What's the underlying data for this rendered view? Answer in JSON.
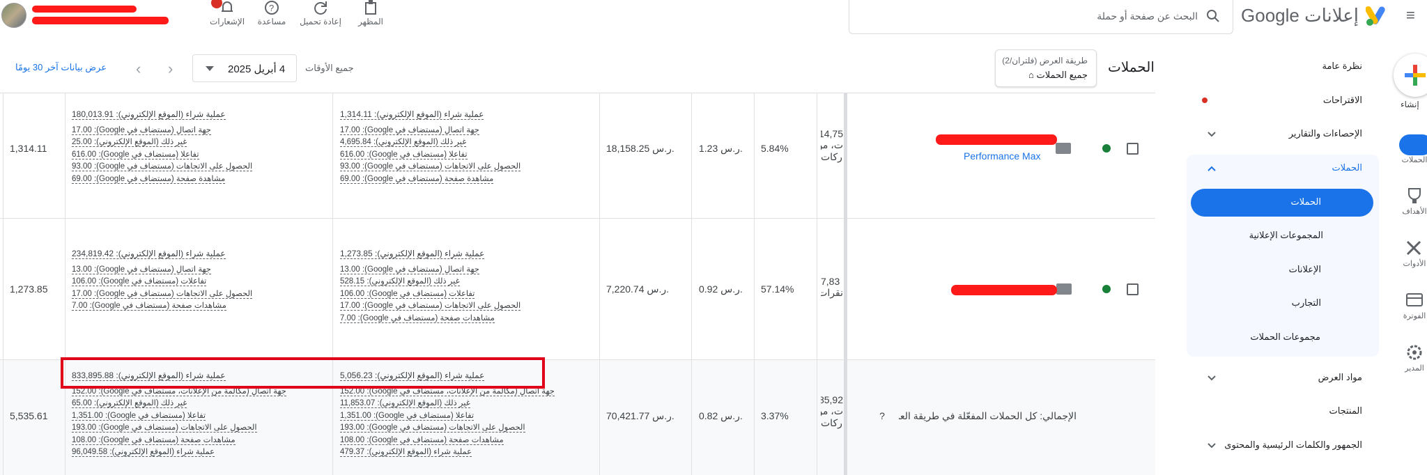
{
  "topbar": {
    "brand_text": "إعلانات",
    "brand_google": "Google",
    "search_placeholder": "البحث عن صفحة أو حملة",
    "tools": [
      {
        "label": "المظهر",
        "icon": "appearance-icon"
      },
      {
        "label": "إعادة تحميل",
        "icon": "refresh-icon"
      },
      {
        "label": "مساعدة",
        "icon": "help-icon"
      },
      {
        "label": "الإشعارات",
        "icon": "bell-icon"
      }
    ]
  },
  "rail": {
    "create": "إنشاء",
    "items": [
      {
        "label": "الحملات",
        "icon": "megaphone-icon",
        "active": true
      },
      {
        "label": "الأهداف",
        "icon": "trophy-icon",
        "active": false
      },
      {
        "label": "الأدوات",
        "icon": "tools-icon",
        "active": false
      },
      {
        "label": "الفوترة",
        "icon": "card-icon",
        "active": false
      },
      {
        "label": "المدير",
        "icon": "gear-icon",
        "active": false
      }
    ]
  },
  "nav": {
    "overview": "نظرة عامة",
    "suggestions": "الاقتراحات",
    "stats": "الإحصاءات والتقارير",
    "campaigns_group": "الحملات",
    "sub": [
      "الحملات",
      "المجموعات الإعلانية",
      "الإعلانات",
      "التجارب",
      "مجموعات الحملات"
    ],
    "assets": "مواد العرض",
    "products": "المنتجات",
    "audience": "الجمهور والكلمات الرئيسية والمحتوى"
  },
  "header": {
    "title": "الحملات",
    "view_label": "طريقة العرض (فلتران/2)",
    "view_value": "جميع الحملات",
    "all_time": "جميع الأوقات",
    "date": "4 أبريل 2025",
    "last30": "عرض بيانات آخر 30 يومًا"
  },
  "rows": [
    {
      "campaign_name": "Performance Max",
      "impr_partial": [
        "14,75",
        "ت، من",
        "ركات"
      ],
      "ctr": "5.84%",
      "avg_cost": "1.23 ر.س.",
      "cost": "18,158.25 ر.س.",
      "conv_main": "عملية شراء (الموقع الإلكتروني): 1,314.11",
      "conv_lines": [
        "جهة اتصال (مستضاف في Google): 17.00",
        "غير ذلك (الموقع الإلكتروني): 4,695.84",
        "تفاعلا (مستضاف في Google): 616.00",
        "الحصول على الاتجاهات (مستضاف في Google): 93.00",
        "مشاهدة صفحة (مستضاف في Google): 69.00"
      ],
      "value_main": "عملية شراء (الموقع الإلكتروني): 180,013.91",
      "value_lines": [
        "جهة اتصال (مستضاف في Google): 17.00",
        "غير ذلك (الموقع الإلكتروني): 25.00",
        "تفاعلا (مستضاف في Google): 616.00",
        "الحصول على الاتجاهات (مستضاف في Google): 93.00",
        "مشاهدة صفحة (مستضاف في Google): 69.00"
      ],
      "last": "1,314.11"
    },
    {
      "impr_partial": [
        "7,83",
        "نقرات"
      ],
      "ctr": "57.14%",
      "avg_cost": "0.92 ر.س.",
      "cost": "7,220.74 ر.س.",
      "conv_main": "عملية شراء (الموقع الإلكتروني): 1,273.85",
      "conv_lines": [
        "جهة اتصال (مستضاف في Google): 13.00",
        "غير ذلك (الموقع الإلكتروني): 528.15",
        "تفاعلات (مستضاف في Google): 106.00",
        "الحصول على الاتجاهات (مستضاف في Google): 17.00",
        "مشاهدات صفحة (مستضاف في Google): 7.00"
      ],
      "value_main": "عملية شراء (الموقع الإلكتروني): 234,819.42",
      "value_lines": [
        "جهة اتصال (مستضاف في Google): 13.00",
        "تفاعلات (مستضاف في Google): 106.00",
        "الحصول على الاتجاهات (مستضاف في Google): 17.00",
        "مشاهدات صفحة (مستضاف في Google): 7.00"
      ],
      "last": "1,273.85"
    },
    {
      "campaign_name": "الإجمالي: كل الحملات المفعّلة في طريقة العر...",
      "impr_partial": [
        "85,92",
        "ت، من",
        "ركات"
      ],
      "ctr": "3.37%",
      "avg_cost": "0.82 ر.س.",
      "cost": "70,421.77 ر.س.",
      "conv_main": "عملية شراء (الموقع الإلكتروني): 5,056.23",
      "conv_lines": [
        "جهة اتصال (مكالمة من الإعلانات، مستضاف في Google): 152.00",
        "غير ذلك (الموقع الإلكتروني): 11,853.07",
        "تفاعلا (مستضاف في Google): 1,351.00",
        "الحصول على الاتجاهات (مستضاف في Google): 193.00",
        "مشاهدات صفحة (مستضاف في Google): 108.00",
        "عملية شراء (الموقع الإلكتروني): 479.37"
      ],
      "value_main": "عملية شراء (الموقع الإلكتروني): 833,895.88",
      "value_lines": [
        "جهة اتصال (مكالمة من الإعلانات، مستضاف في Google): 152.00",
        "غير ذلك (الموقع الإلكتروني): 65.00",
        "تفاعلا (مستضاف في Google): 1,351.00",
        "الحصول على الاتجاهات (مستضاف في Google): 193.00",
        "مشاهدات صفحة (مستضاف في Google): 108.00",
        "عملية شراء (الموقع الإلكتروني): 96,049.58"
      ],
      "last": "5,535.61"
    }
  ]
}
